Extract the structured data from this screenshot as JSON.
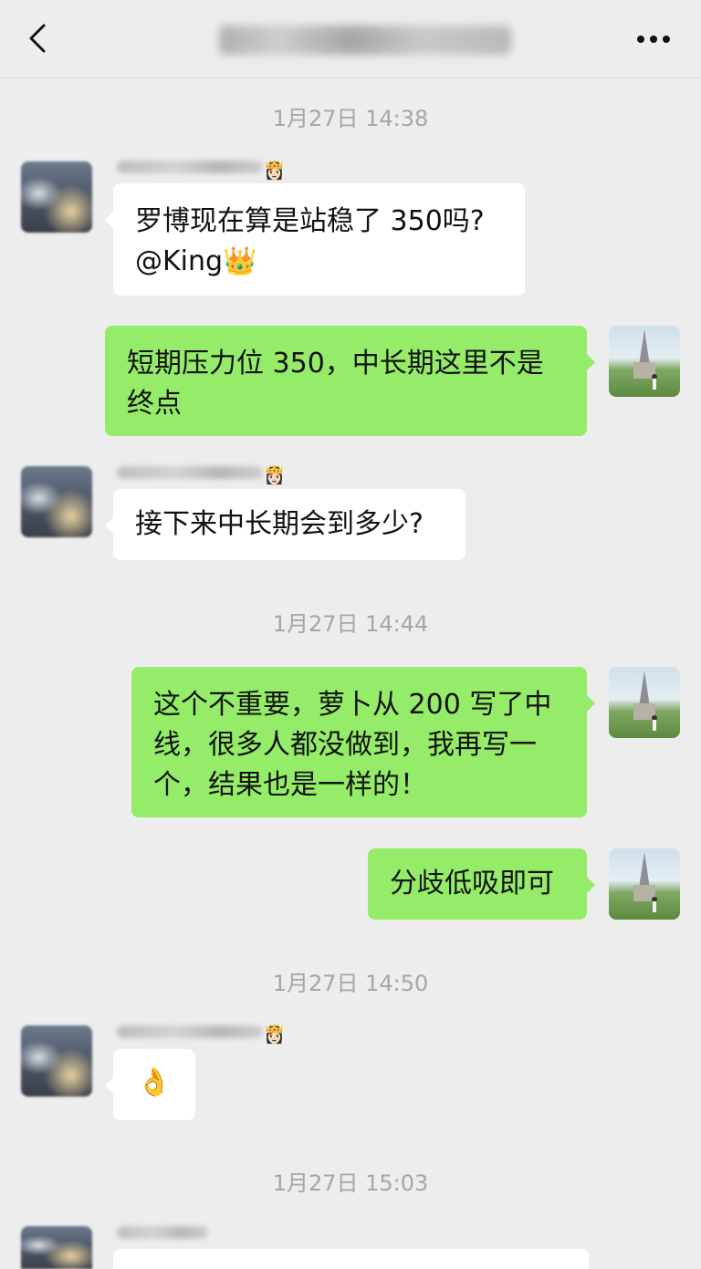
{
  "header": {
    "back_icon": "chevron-left-icon",
    "title": "盘中操作交流群",
    "more_icon": "more-dots-icon"
  },
  "timestamps": [
    "1月27日 14:38",
    "1月27日 14:44",
    "1月27日 14:50",
    "1月27日 15:03"
  ],
  "messages": [
    {
      "side": "left",
      "name_emoji": "👸🏻",
      "text_line1": "罗博现在算是站稳了 350吗?",
      "text_line2": "@King👑"
    },
    {
      "side": "right",
      "text_line1": "短期压力位 350，中长期这里不是",
      "text_line2": "终点"
    },
    {
      "side": "left",
      "name_emoji": "👸🏻",
      "text": "接下来中长期会到多少?"
    },
    {
      "side": "right",
      "text_line1": "这个不重要，萝卜从 200 写了中",
      "text_line2": "线，很多人都没做到，我再写一",
      "text_line3": "个，结果也是一样的！"
    },
    {
      "side": "right",
      "text": "分歧低吸即可"
    },
    {
      "side": "left",
      "name_emoji": "👸🏻",
      "text": "👌"
    }
  ],
  "colors": {
    "background": "#ededed",
    "bubble_self": "#95ec69",
    "bubble_other": "#ffffff",
    "timestamp": "#a6a6a6"
  }
}
